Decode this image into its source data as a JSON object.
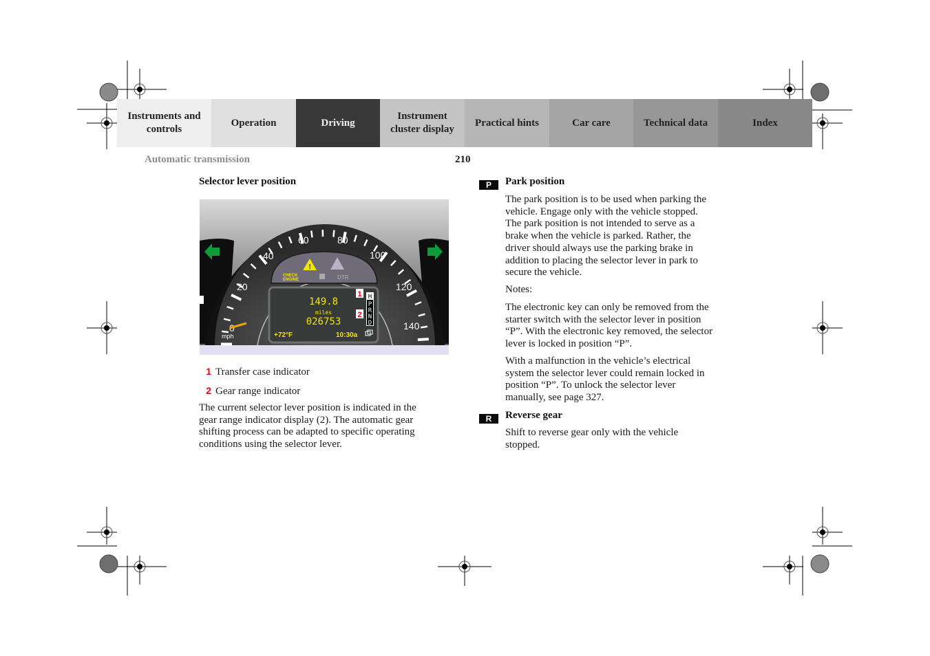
{
  "nav": {
    "tabs": [
      {
        "label": "Instruments and controls",
        "bg": "#efefef",
        "active": false
      },
      {
        "label": "Operation",
        "bg": "#e0e0e0",
        "active": false
      },
      {
        "label": "Driving",
        "bg": "#383838",
        "active": true
      },
      {
        "label": "Instrument cluster display",
        "bg": "#c4c4c4",
        "active": false
      },
      {
        "label": "Practical hints",
        "bg": "#b5b5b5",
        "active": false
      },
      {
        "label": "Car care",
        "bg": "#a6a6a6",
        "active": false
      },
      {
        "label": "Technical data",
        "bg": "#979797",
        "active": false
      },
      {
        "label": "Index",
        "bg": "#888888",
        "active": false
      }
    ]
  },
  "header": {
    "running_head": "Automatic transmission",
    "page_number": "210"
  },
  "left": {
    "section_title": "Selector lever position",
    "figure": {
      "speed_labels": [
        "20",
        "40",
        "60",
        "80",
        "100",
        "120",
        "140"
      ],
      "zero_label": "0",
      "unit": "mph",
      "check_engine_line1": "CHECK",
      "check_engine_line2": "ENGINE",
      "dtr_label": "DTR",
      "trip": "149.8",
      "distance_unit": "miles",
      "odometer": "026753",
      "temperature": "+72°F",
      "clock": "10:30a",
      "transfer_case_letter": "H",
      "gear_letters": [
        "P",
        "R",
        "N",
        "D"
      ],
      "callout_1": "1",
      "callout_2": "2",
      "display_color": "#f2e600",
      "callout_color": "#e3000f",
      "arrow_color": "#0f9a3c"
    },
    "legend": [
      {
        "num": "1",
        "text": "Transfer case indicator"
      },
      {
        "num": "2",
        "text": "Gear range indicator"
      }
    ],
    "paragraph_lines": [
      "The current selector lever position is indicated in the",
      "gear range indicator display (2). The automatic gear",
      "shifting process can be adapted to specific operating",
      "conditions using the selector lever."
    ]
  },
  "right": {
    "park": {
      "badge": "P",
      "title": "Park position",
      "lines": [
        "The park position is to be used when parking the",
        "vehicle. Engage only with the vehicle stopped.",
        "The park position is not intended to serve as a",
        "brake when the vehicle is parked. Rather, the",
        "driver should always use the parking brake in",
        "addition to placing the selector lever in park to",
        "secure the vehicle."
      ],
      "notes_label": "Notes:",
      "note1_lines": [
        "The electronic key can only be removed from the",
        "starter switch with the selector lever in position",
        "“P”. With the electronic key removed, the selector",
        "lever is locked in position “P”."
      ],
      "note2_lines": [
        "With a malfunction in the vehicle’s electrical",
        "system the selector lever could remain locked in",
        "position “P”. To unlock the selector lever",
        "manually, see page 327."
      ]
    },
    "reverse": {
      "badge": "R",
      "title": "Reverse gear",
      "lines": [
        "Shift to reverse gear only with the vehicle",
        "stopped."
      ]
    }
  }
}
